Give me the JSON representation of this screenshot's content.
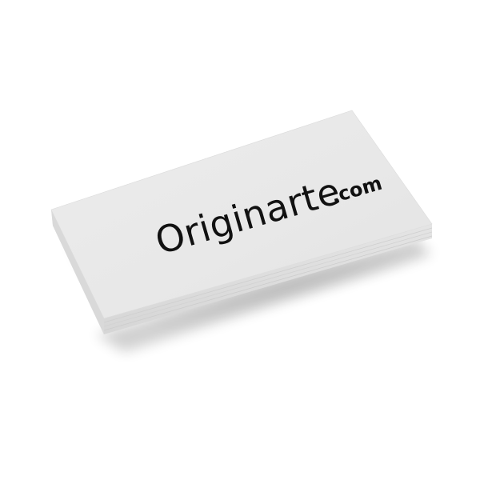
{
  "card": {
    "brand_name": "Originarte",
    "brand_tld": ".com"
  },
  "colors": {
    "background": "#ffffff",
    "card_face": "#e9e9e9",
    "card_edge": "#dedede",
    "text": "#111111"
  }
}
